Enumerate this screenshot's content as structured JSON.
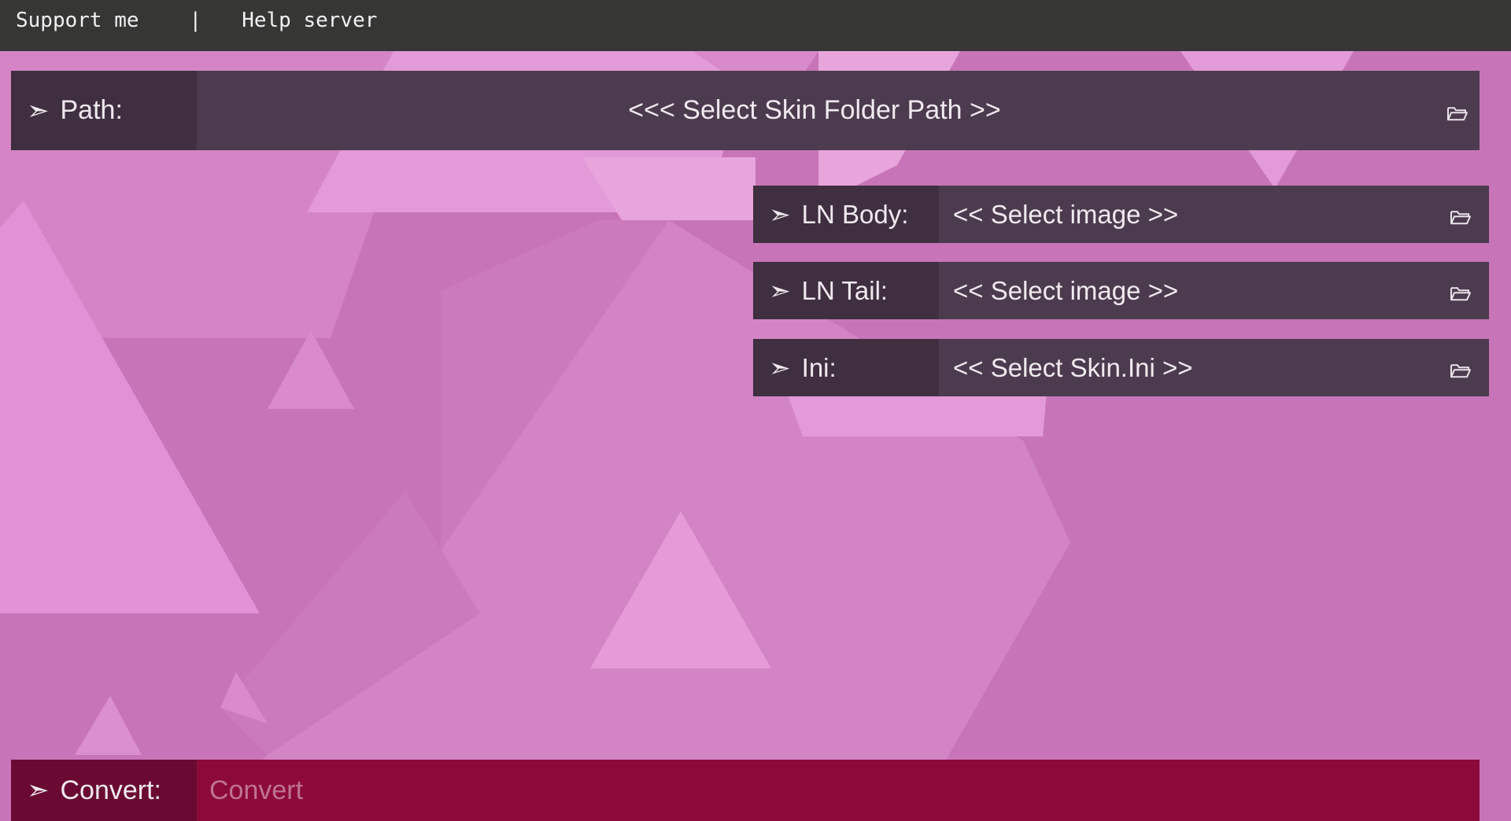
{
  "topbar": {
    "support_label": "Support me",
    "separator": "|",
    "help_label": "Help server"
  },
  "path_row": {
    "arrow": "➣",
    "label": "Path:",
    "value": "<<< Select Skin Folder Path >>",
    "icon": "folder-open-icon"
  },
  "ln_body_row": {
    "arrow": "➣",
    "label": "LN Body:",
    "value": "<< Select image >>",
    "icon": "folder-open-icon"
  },
  "ln_tail_row": {
    "arrow": "➣",
    "label": "LN Tail:",
    "value": "<< Select image >>",
    "icon": "folder-open-icon"
  },
  "ini_row": {
    "arrow": "➣",
    "label": "Ini:",
    "value": "<< Select Skin.Ini >>",
    "icon": "folder-open-icon"
  },
  "convert_row": {
    "arrow": "➣",
    "label": "Convert:",
    "placeholder": "Convert"
  },
  "colors": {
    "background": "#c775b8",
    "topbar": "#363735",
    "label_bg": "#3f2f40",
    "field_bg": "#4c3b4e",
    "convert_label_bg": "#6a0a33",
    "convert_field_bg": "#8c0a3a"
  }
}
